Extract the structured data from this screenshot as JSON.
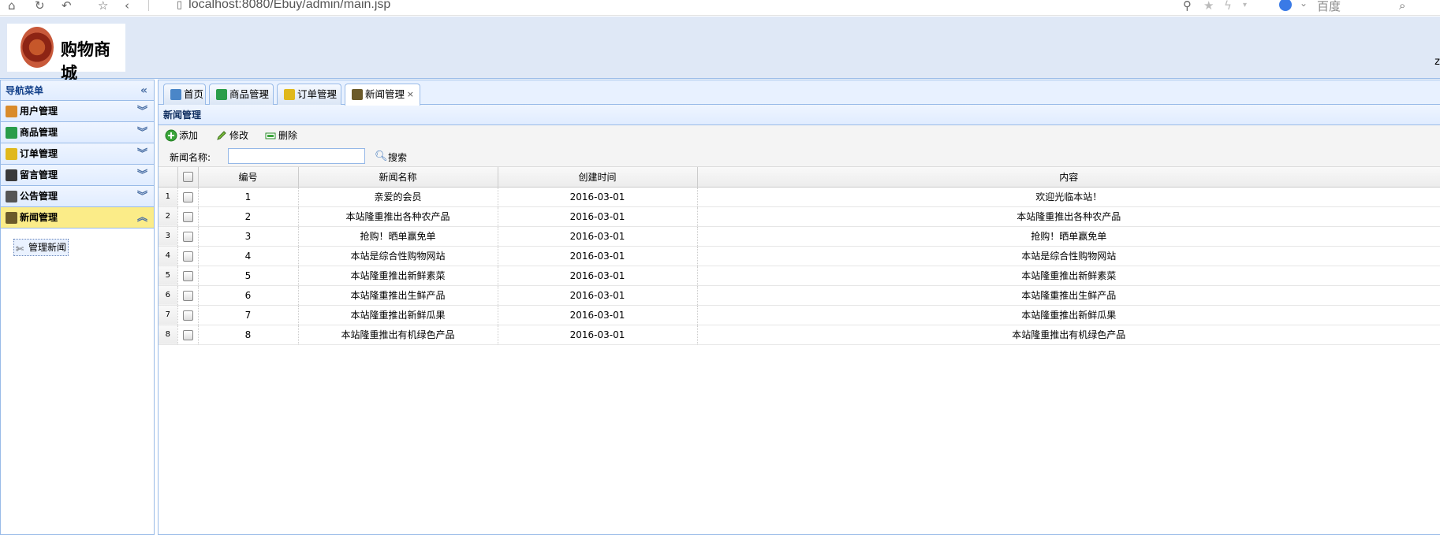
{
  "browser": {
    "url": "localhost:8080/Ebuy/admin/main.jsp",
    "search_engine": "百度"
  },
  "header": {
    "logo_text": "购物商城",
    "edge_text": "z"
  },
  "sidebar": {
    "title": "导航菜单",
    "items": [
      {
        "label": "用户管理",
        "icon": "users-icon",
        "color": "#d98b2b"
      },
      {
        "label": "商品管理",
        "icon": "product-icon",
        "color": "#2a9d4a"
      },
      {
        "label": "订单管理",
        "icon": "order-icon",
        "color": "#e0b81c"
      },
      {
        "label": "留言管理",
        "icon": "comment-icon",
        "color": "#3a3a3a"
      },
      {
        "label": "公告管理",
        "icon": "notice-icon",
        "color": "#555555"
      },
      {
        "label": "新闻管理",
        "icon": "news-icon",
        "color": "#6b5a2a"
      }
    ],
    "active_index": 5,
    "sub_link": "管理新闻"
  },
  "tabs": [
    {
      "label": "首页",
      "icon": "home-icon",
      "closable": false
    },
    {
      "label": "商品管理",
      "icon": "product-icon",
      "closable": true
    },
    {
      "label": "订单管理",
      "icon": "order-icon",
      "closable": true
    },
    {
      "label": "新闻管理",
      "icon": "news-icon",
      "closable": true
    }
  ],
  "panel": {
    "title": "新闻管理",
    "toolbar": {
      "add": "添加",
      "edit": "修改",
      "delete": "删除"
    },
    "search": {
      "label": "新闻名称:",
      "value": "",
      "placeholder": "",
      "button": "搜索"
    }
  },
  "grid": {
    "columns": [
      "编号",
      "新闻名称",
      "创建时间",
      "内容"
    ],
    "rows": [
      {
        "n": "1",
        "id": "1",
        "name": "亲爱的会员",
        "date": "2016-03-01",
        "content": "欢迎光临本站！"
      },
      {
        "n": "2",
        "id": "2",
        "name": "本站隆重推出各种农产品",
        "date": "2016-03-01",
        "content": "本站隆重推出各种农产品"
      },
      {
        "n": "3",
        "id": "3",
        "name": "抢购！晒单赢免单",
        "date": "2016-03-01",
        "content": "抢购！晒单赢免单"
      },
      {
        "n": "4",
        "id": "4",
        "name": "本站是综合性购物网站",
        "date": "2016-03-01",
        "content": "本站是综合性购物网站"
      },
      {
        "n": "5",
        "id": "5",
        "name": "本站隆重推出新鲜素菜",
        "date": "2016-03-01",
        "content": "本站隆重推出新鲜素菜"
      },
      {
        "n": "6",
        "id": "6",
        "name": "本站隆重推出生鲜产品",
        "date": "2016-03-01",
        "content": "本站隆重推出生鲜产品"
      },
      {
        "n": "7",
        "id": "7",
        "name": "本站隆重推出新鲜瓜果",
        "date": "2016-03-01",
        "content": "本站隆重推出新鲜瓜果"
      },
      {
        "n": "8",
        "id": "8",
        "name": "本站隆重推出有机绿色产品",
        "date": "2016-03-01",
        "content": "本站隆重推出有机绿色产品"
      }
    ]
  }
}
